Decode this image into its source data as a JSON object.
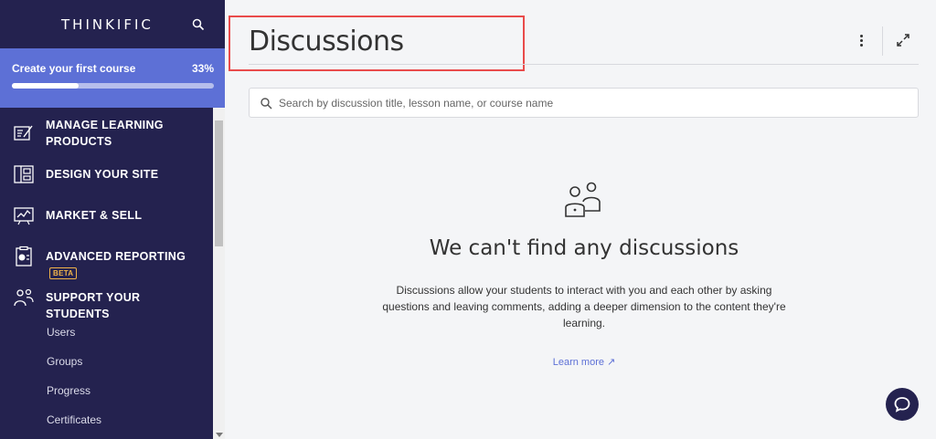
{
  "sidebar": {
    "logo": "THINKIFIC",
    "progress": {
      "title": "Create your first course",
      "percent_label": "33%",
      "fraction": 0.33
    },
    "nav": [
      {
        "label": "MANAGE LEARNING PRODUCTS",
        "icon": "edit-document-icon"
      },
      {
        "label": "DESIGN YOUR SITE",
        "icon": "layout-icon"
      },
      {
        "label": "MARKET & SELL",
        "icon": "chart-board-icon"
      },
      {
        "label": "ADVANCED REPORTING",
        "icon": "report-icon",
        "badge": "BETA"
      },
      {
        "label": "SUPPORT YOUR STUDENTS",
        "icon": "students-icon"
      }
    ],
    "sub_items": [
      "Users",
      "Groups",
      "Progress",
      "Certificates"
    ]
  },
  "main": {
    "title": "Discussions",
    "search": {
      "placeholder": "Search by discussion title, lesson name, or course name"
    },
    "empty_state": {
      "icon": "discussion-people-icon",
      "title": "We can't find any discussions",
      "description": "Discussions allow your students to interact with you and each other by asking questions and leaving comments, adding a deeper dimension to the content they're learning.",
      "link": "Learn more ↗"
    }
  },
  "colors": {
    "sidebar_bg": "#24224f",
    "accent": "#5d70d6",
    "highlight_border": "#e94b4b",
    "page_bg": "#f4f5f7"
  }
}
